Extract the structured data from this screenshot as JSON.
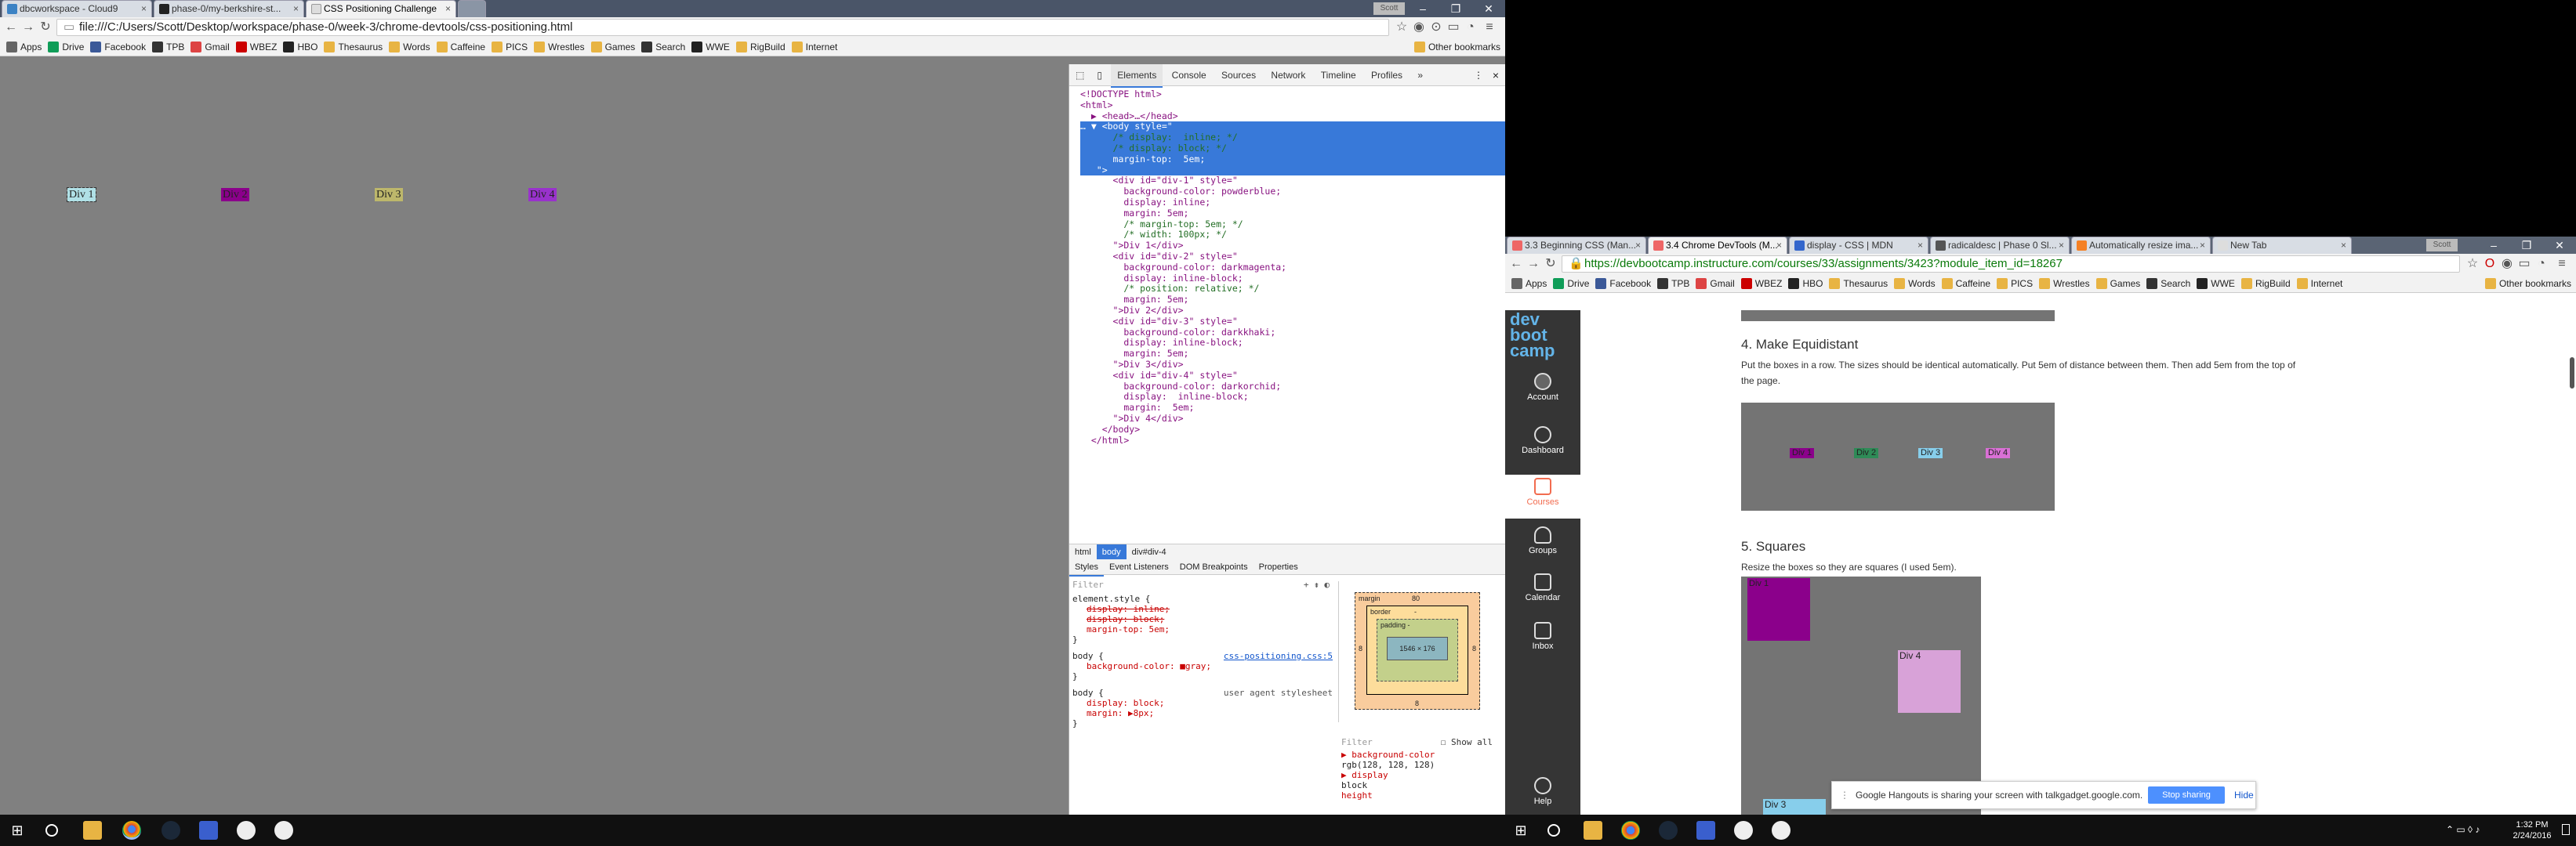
{
  "left_window": {
    "tabs": [
      {
        "label": "dbcworkspace - Cloud9"
      },
      {
        "label": "phase-0/my-berkshire-st..."
      },
      {
        "label": "CSS Positioning Challenge"
      }
    ],
    "user_badge": "Scott",
    "url": "file:///C:/Users/Scott/Desktop/workspace/phase-0/week-3/chrome-devtools/css-positioning.html",
    "bookmarks": [
      "Apps",
      "Drive",
      "Facebook",
      "TPB",
      "Gmail",
      "WBEZ",
      "HBO",
      "Thesaurus",
      "Words",
      "Caffeine",
      "PICS",
      "Wrestles",
      "Games",
      "Search",
      "WWE",
      "RigBuild",
      "Internet"
    ],
    "other_bookmarks": "Other bookmarks",
    "demo_divs": [
      {
        "label": "Div 1",
        "color": "#b0e0e6"
      },
      {
        "label": "Div 2",
        "color": "#8b008b"
      },
      {
        "label": "Div 3",
        "color": "#bdb76b"
      },
      {
        "label": "Div 4",
        "color": "#9932cc"
      }
    ]
  },
  "devtools": {
    "tabs": [
      "Elements",
      "Console",
      "Sources",
      "Network",
      "Timeline",
      "Profiles"
    ],
    "more": "»",
    "close": "×",
    "code_lines": [
      "<!DOCTYPE html>",
      "<html>",
      "  ▶ <head>…</head>",
      "… ▼ <body style=\"",
      "      /* display:  inline; */",
      "      /* display: block; */",
      "      margin-top:  5em;",
      "   \">",
      "      <div id=\"div-1\" style=\"",
      "        background-color: powderblue;",
      "        display: inline;",
      "        margin: 5em;",
      "        /* margin-top: 5em; */",
      "        /* width: 100px; */",
      "      \">Div 1</div>",
      "      <div id=\"div-2\" style=\"",
      "        background-color: darkmagenta;",
      "        display: inline-block;",
      "        /* position: relative; */",
      "        margin: 5em;",
      "      \">Div 2</div>",
      "      <div id=\"div-3\" style=\"",
      "        background-color: darkkhaki;",
      "        display: inline-block;",
      "        margin: 5em;",
      "      \">Div 3</div>",
      "      <div id=\"div-4\" style=\"",
      "        background-color: darkorchid;",
      "        display:  inline-block;",
      "        margin:  5em;",
      "      \">Div 4</div>",
      "    </body>",
      "  </html>"
    ],
    "highlight_lines": [
      3,
      4,
      5,
      6,
      7
    ],
    "breadcrumbs": [
      "html",
      "body",
      "div#div-4"
    ],
    "subtabs": [
      "Styles",
      "Event Listeners",
      "DOM Breakpoints",
      "Properties"
    ],
    "filter_placeholder": "Filter",
    "styles": {
      "element_style": "element.style {",
      "rule1_props": [
        "display: inline;",
        "display: block;",
        "margin-top: 5em;"
      ],
      "body_sel": "body {",
      "body_src": "css-positioning.css:5",
      "body_prop": "background-color: ■gray;",
      "ua_sel": "body {",
      "ua_src": "user agent stylesheet",
      "ua_props": [
        "display: block;",
        "margin: ▶8px;"
      ],
      "close": "}"
    },
    "boxmodel": {
      "margin_label": "margin",
      "margin_top": "80",
      "border_label": "border",
      "padding_label": "padding -",
      "content": "1546 × 176",
      "left": "8",
      "right": "8",
      "dash": "-",
      "bottom": "8"
    },
    "computed": {
      "filter": "Filter",
      "show_all": "Show all",
      "items": [
        "▶ background-color",
        "  rgb(128, 128, 128)",
        "▶ display",
        "  block",
        "  height"
      ]
    }
  },
  "right_window": {
    "tabs": [
      {
        "label": "3.3 Beginning CSS (Man..."
      },
      {
        "label": "3.4 Chrome DevTools (M..."
      },
      {
        "label": "display - CSS | MDN"
      },
      {
        "label": "radicaldesc | Phase 0 Sl..."
      },
      {
        "label": "Automatically resize ima..."
      },
      {
        "label": "New Tab"
      }
    ],
    "user_badge": "Scott",
    "url": "https://devbootcamp.instructure.com/courses/33/assignments/3423?module_item_id=18267",
    "bookmarks": [
      "Apps",
      "Drive",
      "Facebook",
      "TPB",
      "Gmail",
      "WBEZ",
      "HBO",
      "Thesaurus",
      "Words",
      "Caffeine",
      "PICS",
      "Wrestles",
      "Games",
      "Search",
      "WWE",
      "RigBuild",
      "Internet"
    ],
    "other_bookmarks": "Other bookmarks",
    "logo_lines": [
      "dev",
      "boot",
      "camp"
    ],
    "sidebar": [
      "Account",
      "Dashboard",
      "Courses",
      "Groups",
      "Calendar",
      "Inbox",
      "Help"
    ],
    "section4_title": "4. Make Equidistant",
    "section4_text": "Put the boxes in a row. The sizes should be identical automatically. Put 5em of distance between them. Then add 5em from the top of the page.",
    "equi_divs": [
      "Div 1",
      "Div 2",
      "Div 3",
      "Div 4"
    ],
    "section5_title": "5. Squares",
    "section5_text": "Resize the boxes so they are squares (I used 5em).",
    "square_labels": [
      "Div 1",
      "Div 4",
      "Div 3"
    ],
    "notice": "Google Hangouts is sharing your screen with talkgadget.google.com.",
    "stop_sharing": "Stop sharing",
    "hide": "Hide"
  },
  "taskbar": {
    "time": "1:32 PM",
    "date": "2/24/2016"
  }
}
